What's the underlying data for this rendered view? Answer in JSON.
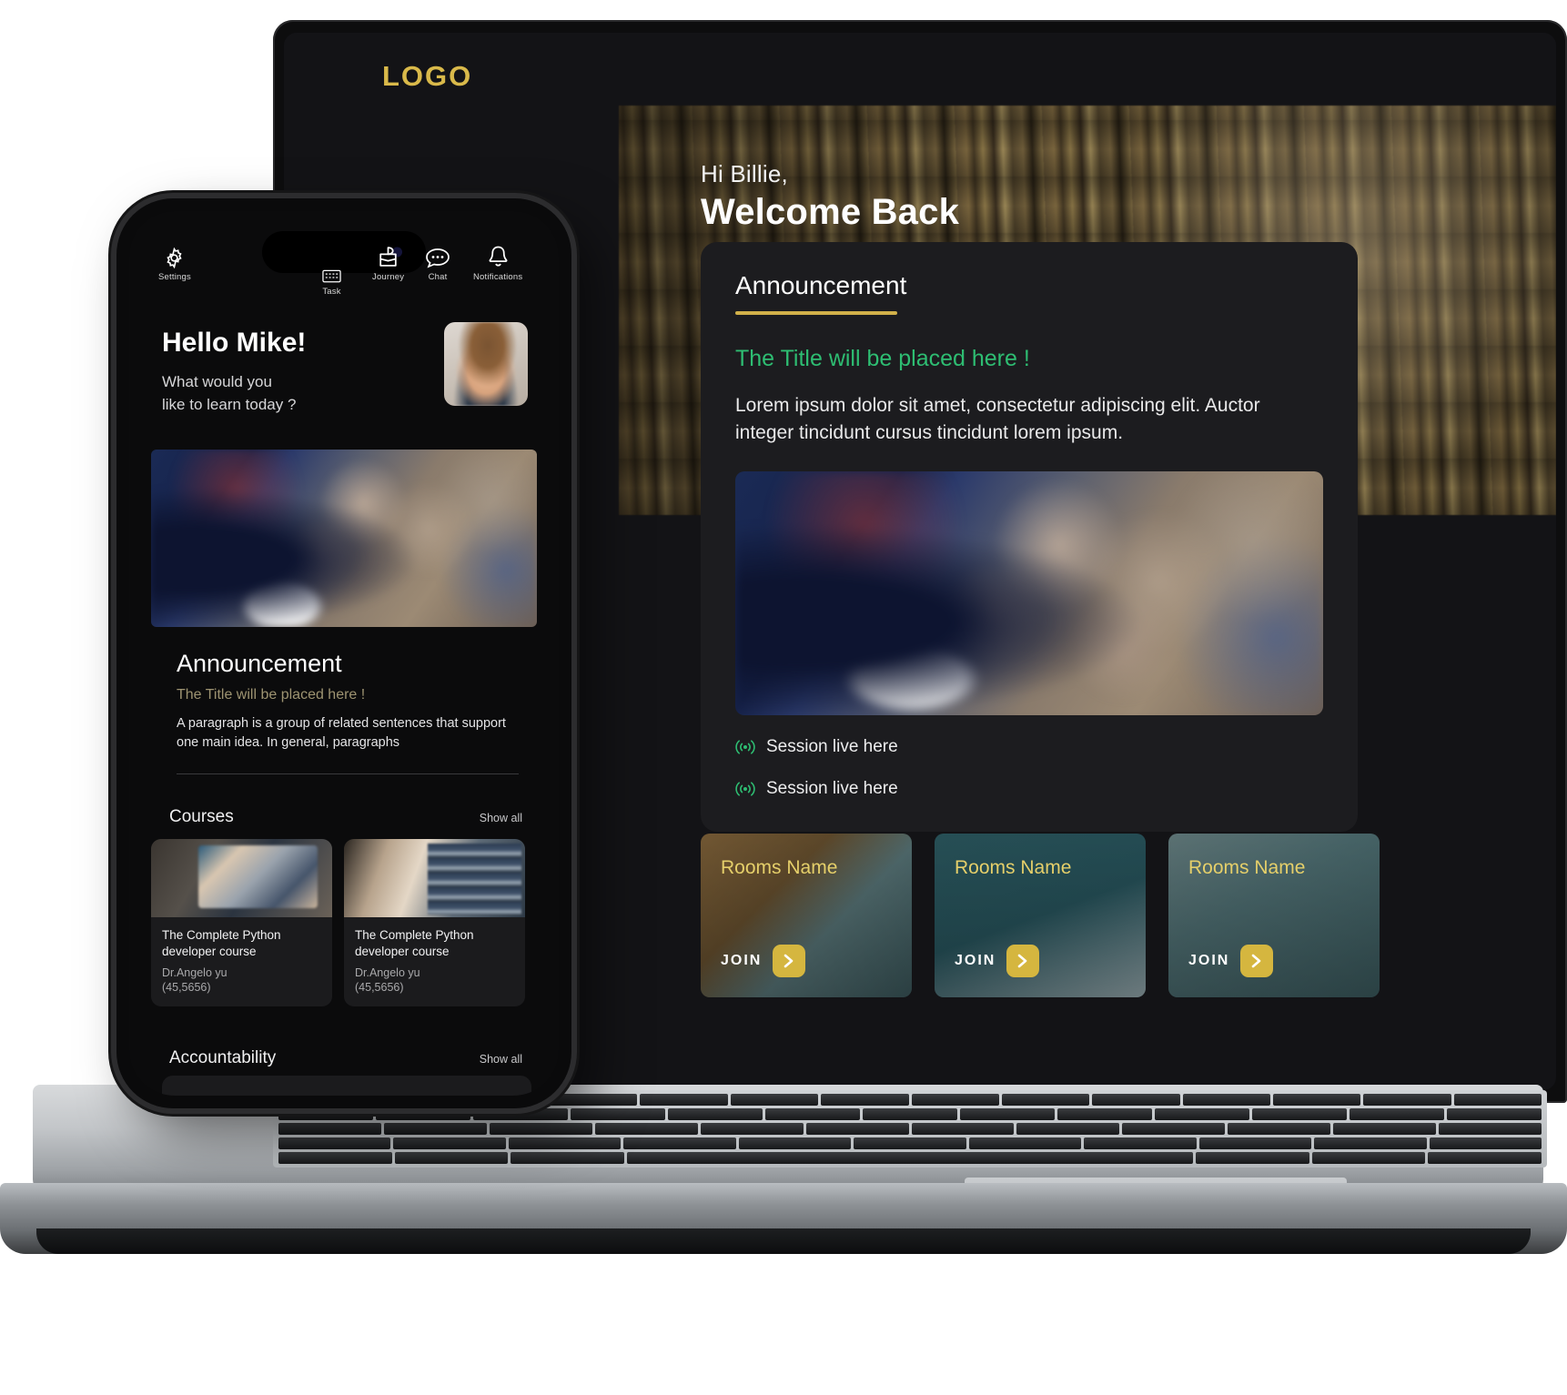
{
  "brand": {
    "logo": "LOGO",
    "gold": "#d9b94a",
    "green": "#2ebd72",
    "teal": "#2f6068"
  },
  "desktop": {
    "greeting_small": "Hi Billie,",
    "greeting_large": "Welcome Back",
    "announcement": {
      "heading": "Announcement",
      "title": "The Title will be placed here !",
      "body": "Lorem ipsum dolor sit amet, consectetur adipiscing elit. Auctor integer tincidunt cursus tincidunt lorem ipsum.",
      "live_sessions": [
        {
          "label": "Session live here",
          "icon": "broadcast-icon"
        },
        {
          "label": "Session live here",
          "icon": "broadcast-icon"
        }
      ]
    },
    "rooms": [
      {
        "name": "Rooms Name",
        "join_label": "JOIN",
        "arrow_icon": "chevron-right-icon"
      },
      {
        "name": "Rooms Name",
        "join_label": "JOIN",
        "arrow_icon": "chevron-right-icon"
      },
      {
        "name": "Rooms Name",
        "join_label": "JOIN",
        "arrow_icon": "chevron-right-icon"
      }
    ]
  },
  "phone": {
    "nav": [
      {
        "label": "Settings",
        "icon": "gear-icon"
      },
      {
        "label": "Task",
        "icon": "task-list-icon"
      },
      {
        "label": "Journey",
        "icon": "journey-box-icon"
      },
      {
        "label": "Chat",
        "icon": "chat-bubble-icon"
      },
      {
        "label": "Notifications",
        "icon": "bell-icon"
      }
    ],
    "hello_title": "Hello Mike!",
    "hello_sub_line1": "What would you",
    "hello_sub_line2": "like to learn today ?",
    "announcement": {
      "heading": "Announcement",
      "title": "The Title will be placed here !",
      "body": "A paragraph is a group of related sentences that support one main idea. In general, paragraphs"
    },
    "sections": {
      "courses": {
        "title": "Courses",
        "show_all": "Show all"
      },
      "accountability": {
        "title": "Accountability",
        "show_all": "Show all"
      }
    },
    "courses": [
      {
        "title": "The Complete Python developer course",
        "author": "Dr.Angelo yu",
        "rating": "(45,5656)"
      },
      {
        "title": "The Complete Python developer course",
        "author": "Dr.Angelo yu",
        "rating": "(45,5656)"
      }
    ]
  }
}
